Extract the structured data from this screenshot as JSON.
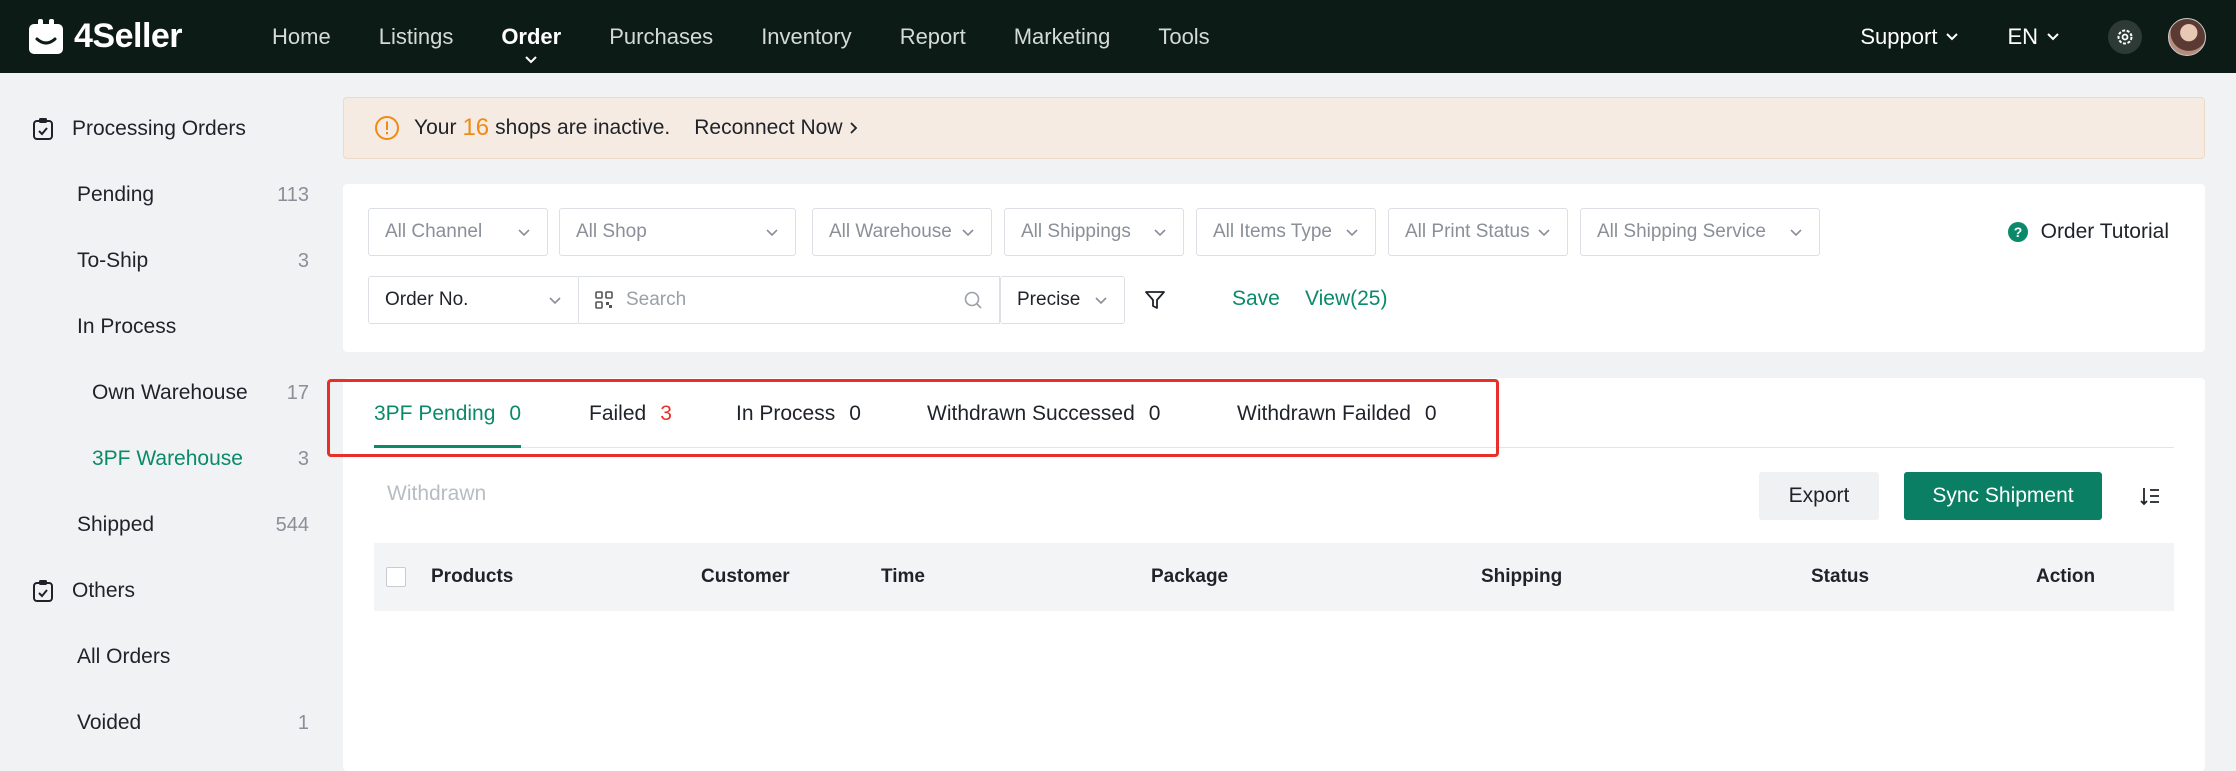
{
  "app": {
    "name": "4Seller"
  },
  "nav": {
    "items": [
      "Home",
      "Listings",
      "Order",
      "Purchases",
      "Inventory",
      "Report",
      "Marketing",
      "Tools"
    ],
    "active": "Order"
  },
  "top_right": {
    "support": "Support",
    "language": "EN"
  },
  "sidebar": {
    "processing_title": "Processing Orders",
    "pending": {
      "label": "Pending",
      "count": "113"
    },
    "to_ship": {
      "label": "To-Ship",
      "count": "3"
    },
    "in_process": {
      "label": "In Process"
    },
    "own_warehouse": {
      "label": "Own Warehouse",
      "count": "17"
    },
    "tpf_warehouse": {
      "label": "3PF Warehouse",
      "count": "3"
    },
    "shipped": {
      "label": "Shipped",
      "count": "544"
    },
    "others_title": "Others",
    "all_orders": {
      "label": "All Orders"
    },
    "voided": {
      "label": "Voided",
      "count": "1"
    }
  },
  "banner": {
    "prefix": "Your",
    "count": "16",
    "suffix": "shops are inactive.",
    "action": "Reconnect Now"
  },
  "filters": {
    "channel": "All Channel",
    "shop": "All Shop",
    "warehouse": "All Warehouse",
    "shippings": "All Shippings",
    "items_type": "All Items Type",
    "print_status": "All Print Status",
    "shipping_service": "All Shipping Service",
    "tutorial": "Order Tutorial",
    "search_field": "Order No.",
    "search_placeholder": "Search",
    "match_mode": "Precise",
    "save": "Save",
    "view": "View(25)"
  },
  "tabs": [
    {
      "label": "3PF Pending",
      "count": "0"
    },
    {
      "label": "Failed",
      "count": "3"
    },
    {
      "label": "In Process",
      "count": "0"
    },
    {
      "label": "Withdrawn Successed",
      "count": "0"
    },
    {
      "label": "Withdrawn Failded",
      "count": "0"
    }
  ],
  "toolbar": {
    "withdrawn": "Withdrawn",
    "export": "Export",
    "sync": "Sync Shipment"
  },
  "table": {
    "columns": [
      "Products",
      "Customer",
      "Time",
      "Package",
      "Shipping",
      "Status",
      "Action"
    ]
  },
  "colors": {
    "brand_green": "#0a8a6a",
    "topbar": "#0d1b17",
    "alert": "#f08a16",
    "highlight": "#e8302b"
  }
}
